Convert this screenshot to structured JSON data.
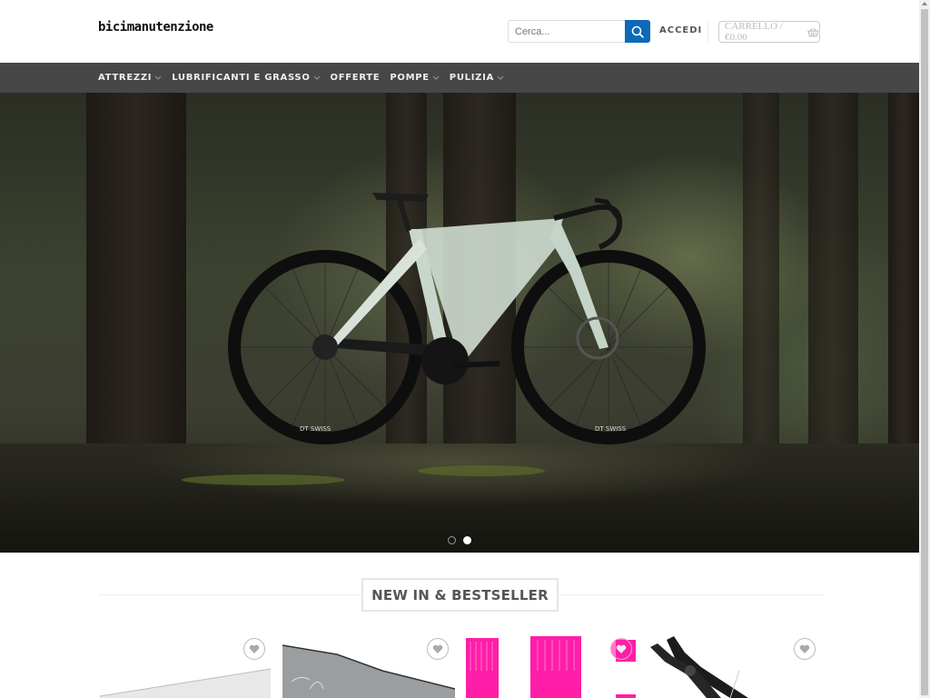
{
  "header": {
    "logo": "bicimanutenzione",
    "search_placeholder": "Cerca...",
    "search_icon": "search-icon",
    "login_label": "ACCEDI",
    "cart_label": "CARRELLO / €0.00",
    "cart_icon": "basket-icon"
  },
  "nav": {
    "items": [
      {
        "label": "ATTREZZI",
        "has_dropdown": true
      },
      {
        "label": "LUBRIFICANTI E GRASSO",
        "has_dropdown": true
      },
      {
        "label": "OFFERTE",
        "has_dropdown": false
      },
      {
        "label": "POMPE",
        "has_dropdown": true
      },
      {
        "label": "PULIZIA",
        "has_dropdown": true
      }
    ]
  },
  "hero": {
    "image": "gravel-bike-in-forest",
    "slides": 2,
    "active_slide": 2,
    "wheel_brand": "DT SWISS"
  },
  "section": {
    "title": "NEW IN & BESTSELLER"
  },
  "products": [
    {
      "image": "white-product-box",
      "wishlist_icon": "heart-icon"
    },
    {
      "image": "grey-packaging",
      "wishlist_icon": "heart-icon"
    },
    {
      "image": "pink-tool-set",
      "wishlist_icon": "heart-icon"
    },
    {
      "image": "chain-link-pliers",
      "wishlist_icon": "heart-icon"
    }
  ],
  "colors": {
    "accent": "#0d6ab8",
    "nav_bg": "#474747",
    "title_text": "#555555"
  }
}
